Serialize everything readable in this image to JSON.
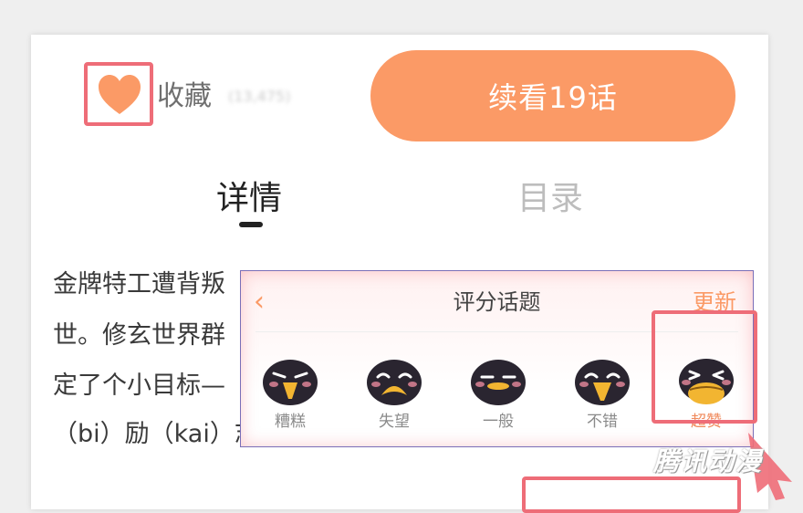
{
  "header": {
    "favorite_label": "收藏",
    "favorite_count": "(13,475)",
    "read_button": "续看19话"
  },
  "tabs": [
    {
      "label": "详情",
      "active": true
    },
    {
      "label": "目录",
      "active": false
    }
  ],
  "description": {
    "lines": [
      "金牌特工遭背叛",
      "世。修玄世界群",
      "定了个小目标—",
      "（bi）励（kai）志"
    ]
  },
  "rating_popup": {
    "back_icon": "chevron-left-icon",
    "title": "评分话题",
    "more_label": "更新",
    "options": [
      {
        "label": "糟糕",
        "icon": "bird-bad-icon"
      },
      {
        "label": "失望",
        "icon": "bird-sad-icon"
      },
      {
        "label": "一般",
        "icon": "bird-neutral-icon"
      },
      {
        "label": "不错",
        "icon": "bird-good-icon"
      },
      {
        "label": "超赞",
        "icon": "bird-great-icon"
      }
    ],
    "selected": "超赞"
  },
  "watermark": "腾讯动漫",
  "colors": {
    "accent": "#fb9a66",
    "highlight": "#ee6d78",
    "heart": "#fb9a66"
  }
}
